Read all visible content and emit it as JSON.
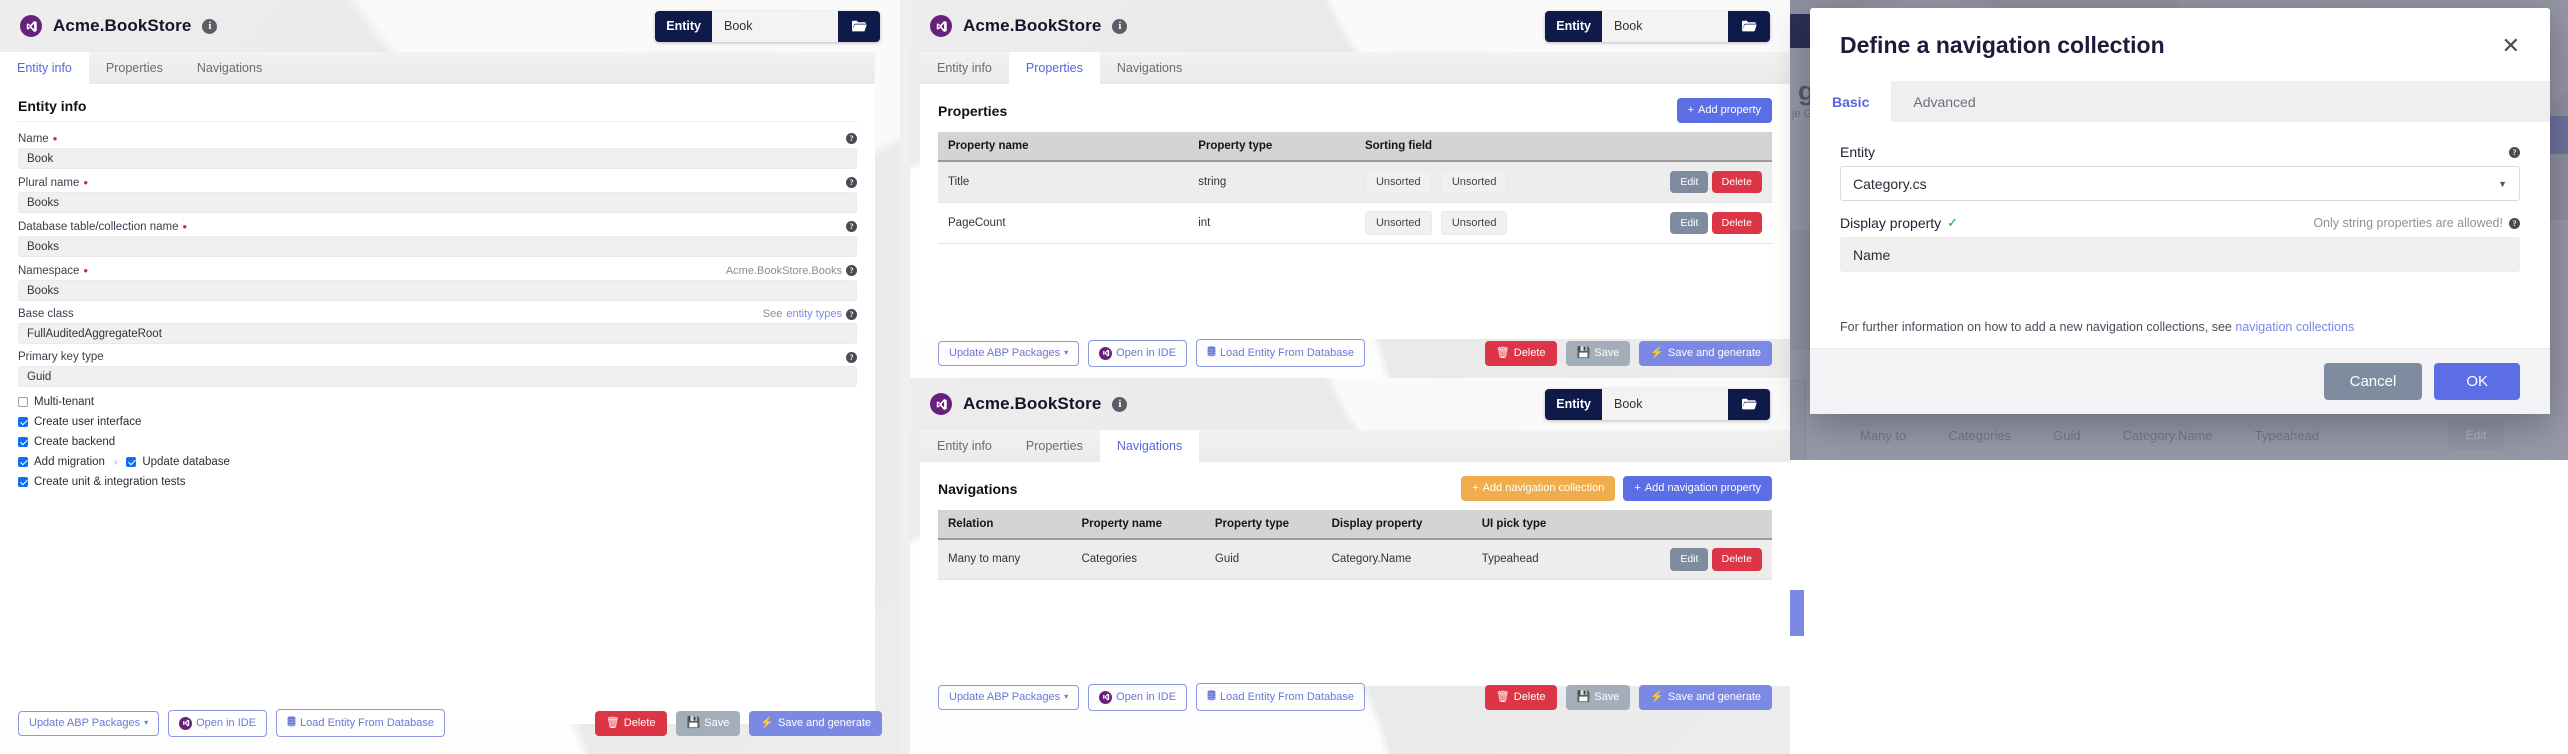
{
  "app": {
    "brand": "Acme.BookStore",
    "entity_label": "Entity",
    "entity_value": "Book",
    "folder_icon": "folder-open-icon",
    "info_icon": "info-icon",
    "logo_icon": "visual-studio-icon"
  },
  "tabs": {
    "entity_info": "Entity info",
    "properties": "Properties",
    "navigations": "Navigations"
  },
  "entity_info": {
    "heading": "Entity info",
    "fields": [
      {
        "label": "Name",
        "required": true,
        "value": "Book",
        "help": true
      },
      {
        "label": "Plural name",
        "required": true,
        "value": "Books",
        "help": true
      },
      {
        "label": "Database table/collection name",
        "required": true,
        "value": "Books",
        "help": true
      },
      {
        "label": "Namespace",
        "required": true,
        "value": "Books",
        "help": true,
        "hint": "Acme.BookStore.Books"
      },
      {
        "label": "Base class",
        "required": false,
        "value": "FullAuditedAggregateRoot",
        "help": true,
        "hint_prefix": "See ",
        "hint_link": "entity types"
      },
      {
        "label": "Primary key type",
        "required": false,
        "value": "Guid",
        "help": true
      }
    ],
    "checkboxes": [
      {
        "label": "Multi-tenant",
        "checked": false
      },
      {
        "label": "Create user interface",
        "checked": true
      },
      {
        "label": "Create backend",
        "checked": true
      },
      {
        "label": "Add migration",
        "checked": true
      },
      {
        "label": "Update database",
        "checked": true
      },
      {
        "label": "Create unit & integration tests",
        "checked": true
      }
    ]
  },
  "properties": {
    "heading": "Properties",
    "add_label": "Add property",
    "columns": [
      "Property name",
      "Property type",
      "Sorting field",
      ""
    ],
    "rows": [
      {
        "name": "Title",
        "type": "string",
        "sort_a": "Unsorted",
        "sort_b": "Unsorted",
        "edit": "Edit",
        "delete": "Delete"
      },
      {
        "name": "PageCount",
        "type": "int",
        "sort_a": "Unsorted",
        "sort_b": "Unsorted",
        "edit": "Edit",
        "delete": "Delete"
      }
    ]
  },
  "navigations": {
    "heading": "Navigations",
    "add_collection_label": "Add navigation collection",
    "add_property_label": "Add navigation property",
    "columns": [
      "Relation",
      "Property name",
      "Property type",
      "Display property",
      "UI pick type",
      ""
    ],
    "rows": [
      {
        "relation": "Many to many",
        "name": "Categories",
        "type": "Guid",
        "display": "Category.Name",
        "pick": "Typeahead",
        "edit": "Edit",
        "delete": "Delete"
      }
    ]
  },
  "toolbar": {
    "update_packages": "Update ABP Packages",
    "open_ide": "Open in IDE",
    "load_entity": "Load Entity From Database",
    "delete": "Delete",
    "save": "Save",
    "save_generate": "Save and generate"
  },
  "modal": {
    "title": "Define a navigation collection",
    "close_icon": "close-icon",
    "tabs": [
      {
        "label": "Basic",
        "active": true
      },
      {
        "label": "Advanced",
        "active": false
      }
    ],
    "entity_label": "Entity",
    "entity_value": "Category.cs",
    "display_label": "Display property",
    "display_hint": "Only string properties are allowed!",
    "display_value": "Name",
    "note_prefix": "For further information on how to add a new navigation collections, see ",
    "note_link": "navigation collections",
    "cancel": "Cancel",
    "ok": "OK"
  },
  "background": {
    "partial_heading": "ge",
    "partial_sub": "je G",
    "partial_row": "Many to",
    "partial_cells": [
      "Categories",
      "Guid",
      "Category.Name",
      "Typeahead"
    ],
    "partial_edit": "Edit"
  },
  "colors": {
    "accent": "#5b6ee6",
    "navy": "#0e1a4a",
    "danger": "#dc3545",
    "warning": "#f0ad4e",
    "purple": "#68217a"
  }
}
